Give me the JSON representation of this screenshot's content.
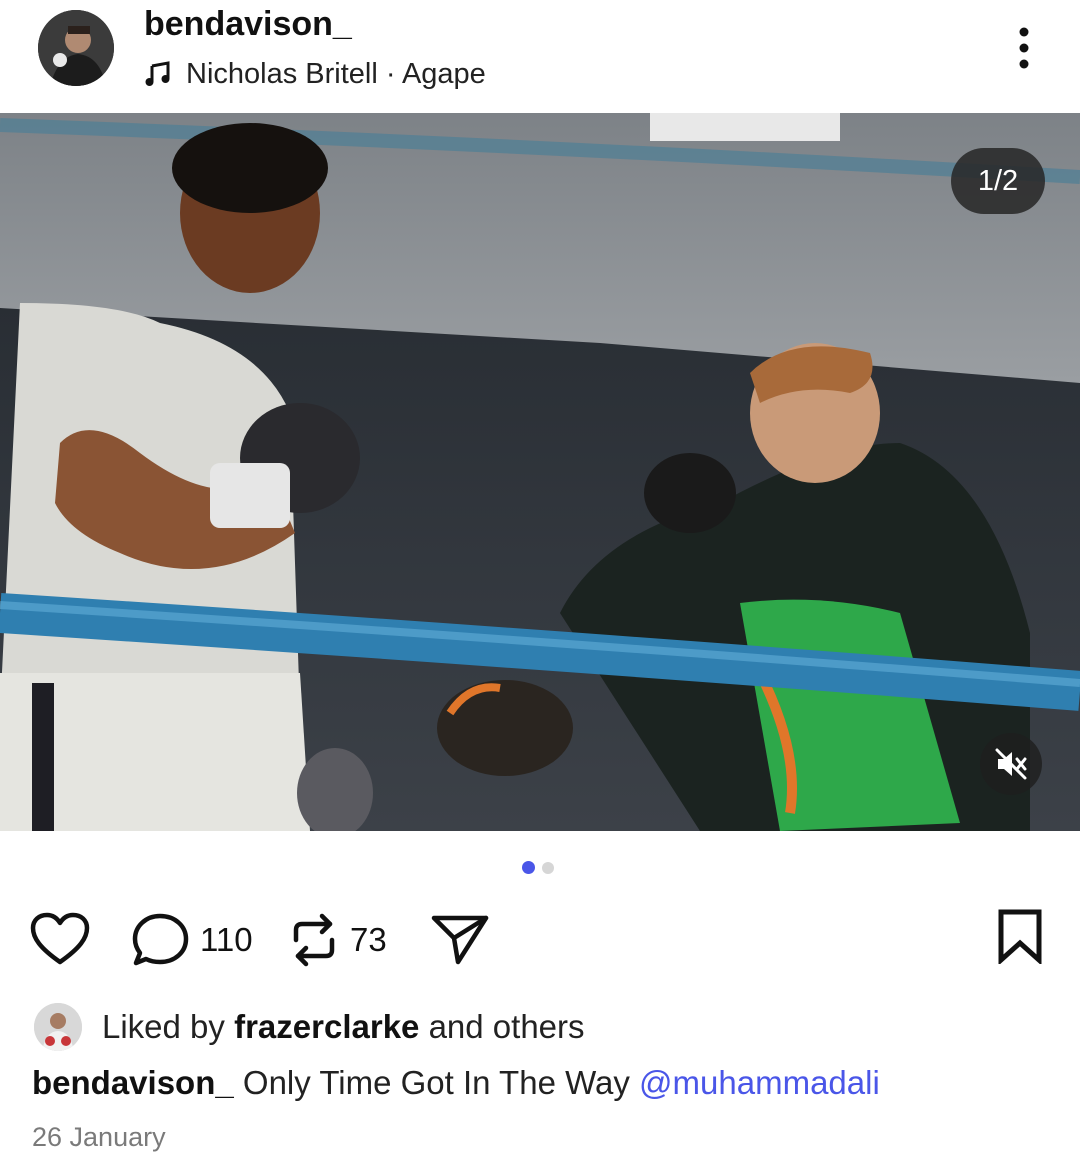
{
  "post": {
    "username": "bendavison_",
    "music": "Nicholas Britell · Agape",
    "media_counter": "1/2",
    "carousel_index": 1,
    "carousel_total": 2
  },
  "actions": {
    "comments_count": "110",
    "reposts_count": "73"
  },
  "likes": {
    "prefix": "Liked by",
    "user": "frazerclarke",
    "suffix": "and others"
  },
  "caption": {
    "username": "bendavison_",
    "text": "Only Time Got In The Way",
    "mention": "@muhammadali"
  },
  "date": "26 January",
  "colors": {
    "accent": "#4a56e8",
    "ring_rope": "#2f7fb0",
    "jacket_green": "#2ea84a"
  }
}
